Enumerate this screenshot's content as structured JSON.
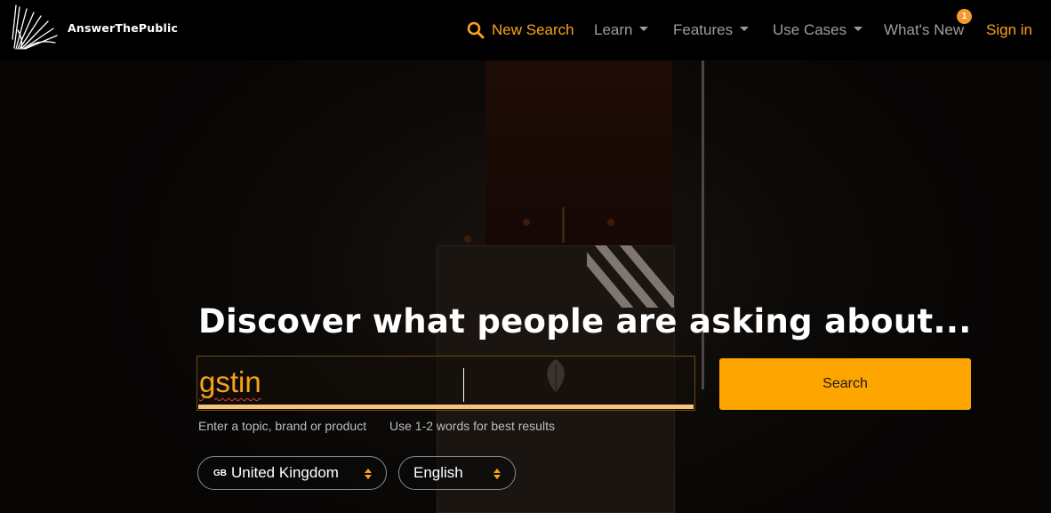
{
  "brand": {
    "name": "AnswerThePublic"
  },
  "nav": {
    "new_search": "New Search",
    "learn": "Learn",
    "features": "Features",
    "use_cases": "Use Cases",
    "whats_new": "What's New",
    "whats_new_badge": "1",
    "sign_in": "Sign in"
  },
  "hero": {
    "headline": "Discover what people are asking about..."
  },
  "search": {
    "value": "gstin",
    "button_label": "Search",
    "hint_topic": "Enter a topic, brand or product",
    "hint_words": "Use 1-2 words for best results"
  },
  "filters": {
    "country_code": "GB",
    "country": "United Kingdom",
    "language": "English"
  },
  "colors": {
    "accent": "#ffa500",
    "nav_muted": "#9d9d9d",
    "badge": "#f59a2f"
  },
  "icons": {
    "search": "search-icon",
    "logo": "logo-icon",
    "caret": "chevron-down-icon",
    "select_arrows": "sort-arrows-icon"
  }
}
